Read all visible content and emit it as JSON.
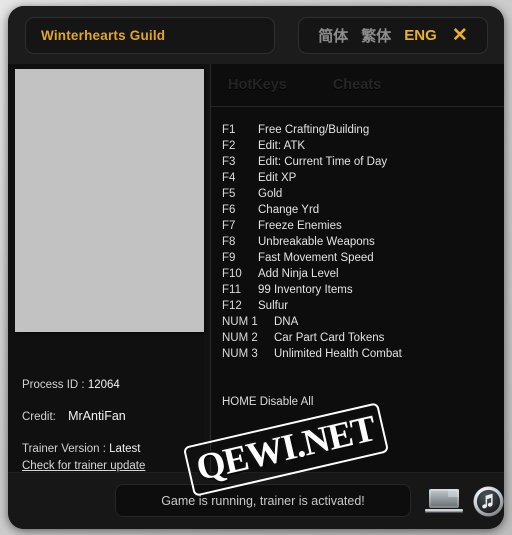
{
  "window": {
    "title": "Winterhearts Guild",
    "accent_color": "#e0a727",
    "close_icon": "✕"
  },
  "languages": [
    {
      "label": "简体",
      "active": false
    },
    {
      "label": "繁体",
      "active": false
    },
    {
      "label": "ENG",
      "active": true
    }
  ],
  "tabs": [
    {
      "label": "HotKeys",
      "active": true
    },
    {
      "label": "Cheats",
      "active": false
    }
  ],
  "hotkeys": [
    {
      "key": "F1",
      "desc": "Free Crafting/Building"
    },
    {
      "key": "F2",
      "desc": "Edit: ATK"
    },
    {
      "key": "F3",
      "desc": "Edit: Current Time of Day"
    },
    {
      "key": "F4",
      "desc": "Edit XP"
    },
    {
      "key": "F5",
      "desc": "Gold"
    },
    {
      "key": "F6",
      "desc": "Change Yrd"
    },
    {
      "key": "F7",
      "desc": "Freeze Enemies"
    },
    {
      "key": "F8",
      "desc": "Unbreakable Weapons"
    },
    {
      "key": "F9",
      "desc": "Fast Movement Speed"
    },
    {
      "key": "F10",
      "desc": "Add Ninja Level"
    },
    {
      "key": "F11",
      "desc": "99 Inventory Items"
    },
    {
      "key": "F12",
      "desc": "Sulfur"
    },
    {
      "key": "NUM 1",
      "desc": "DNA"
    },
    {
      "key": "NUM 2",
      "desc": "Car Part Card Tokens"
    },
    {
      "key": "NUM 3",
      "desc": "Unlimited Health Combat"
    }
  ],
  "disable_all": "HOME Disable All",
  "info": {
    "process_id_label": "Process ID :",
    "process_id_value": "12064",
    "credit_label": "Credit:",
    "credit_value": "MrAntiFan",
    "version_label": "Trainer Version :",
    "version_value": "Latest",
    "update_link": "Check for trainer update"
  },
  "status": {
    "text": "Game is running, trainer is activated!"
  },
  "bottom_icons": [
    {
      "name": "laptop-icon"
    },
    {
      "name": "music-icon"
    }
  ],
  "watermark": {
    "text": "QEWI.NET"
  }
}
